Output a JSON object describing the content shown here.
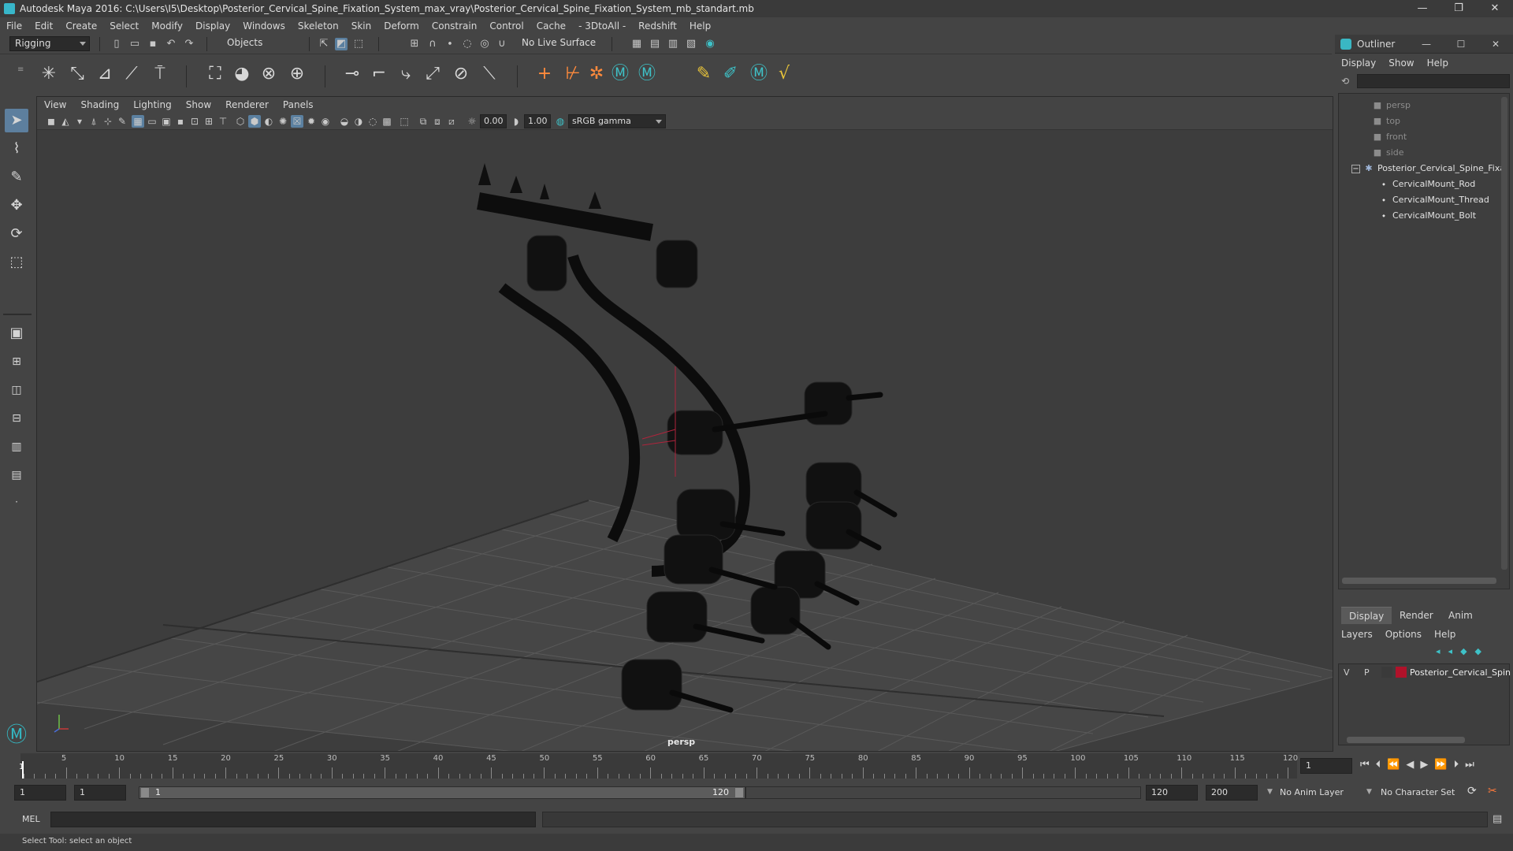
{
  "window": {
    "title": "Autodesk Maya 2016: C:\\Users\\I5\\Desktop\\Posterior_Cervical_Spine_Fixation_System_max_vray\\Posterior_Cervical_Spine_Fixation_System_mb_standart.mb",
    "minimize": "—",
    "restore": "❐",
    "close": "✕"
  },
  "menubar": [
    "File",
    "Edit",
    "Create",
    "Select",
    "Modify",
    "Display",
    "Windows",
    "Skeleton",
    "Skin",
    "Deform",
    "Constrain",
    "Control",
    "Cache",
    "- 3DtoAll -",
    "Redshift",
    "Help"
  ],
  "statusline": {
    "menu_set": "Rigging",
    "selection_mode": "Objects",
    "live_surface": "No Live Surface"
  },
  "viewport": {
    "menu": [
      "View",
      "Shading",
      "Lighting",
      "Show",
      "Renderer",
      "Panels"
    ],
    "near_value": "0.00",
    "far_value": "1.00",
    "color_space": "sRGB gamma",
    "camera_label": "persp"
  },
  "outliner": {
    "title": "Outliner",
    "menu": [
      "Display",
      "Show",
      "Help"
    ],
    "cameras": [
      "persp",
      "top",
      "front",
      "side"
    ],
    "root": "Posterior_Cervical_Spine_Fixa",
    "children": [
      "CervicalMount_Rod",
      "CervicalMount_Thread",
      "CervicalMount_Bolt"
    ]
  },
  "layers": {
    "tabs": [
      "Display",
      "Render",
      "Anim"
    ],
    "menu": [
      "Layers",
      "Options",
      "Help"
    ],
    "row": {
      "v": "V",
      "p": "P",
      "name": "Posterior_Cervical_Spin",
      "color": "#b0122a"
    }
  },
  "timeline": {
    "ticks": [
      "5",
      "10",
      "15",
      "20",
      "25",
      "30",
      "35",
      "40",
      "45",
      "50",
      "55",
      "60",
      "65",
      "70",
      "75",
      "80",
      "85",
      "90",
      "95",
      "100",
      "105",
      "110",
      "115",
      "120"
    ],
    "start_label": "1",
    "current_frame": "1"
  },
  "range": {
    "start": "1",
    "playback_start": "1",
    "slider_start": "1",
    "slider_end": "120",
    "playback_end": "120",
    "end": "200",
    "anim_layer": "No Anim Layer",
    "character_set": "No Character Set"
  },
  "command": {
    "language": "MEL",
    "help": "Select Tool: select an object"
  }
}
